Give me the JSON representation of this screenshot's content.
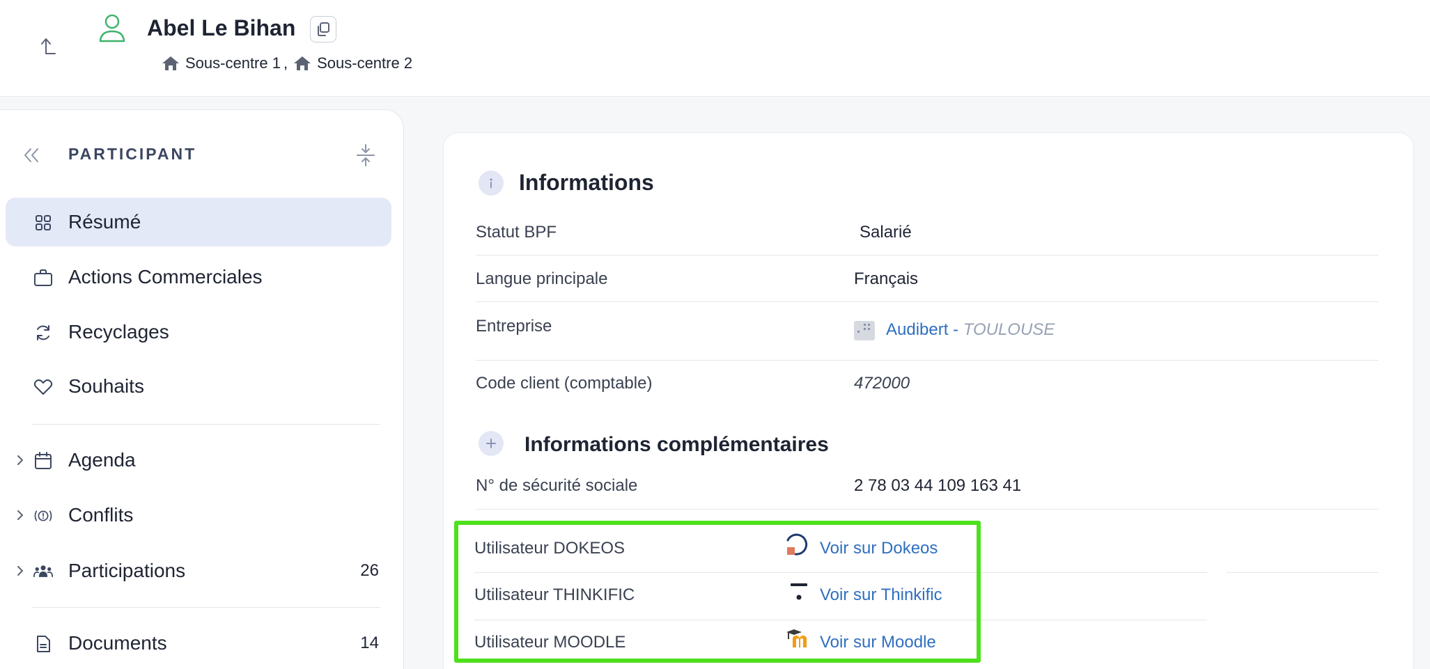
{
  "header": {
    "name": "Abel Le Bihan",
    "centers": [
      "Sous-centre 1",
      "Sous-centre 2"
    ],
    "center_separator": ","
  },
  "sidebar": {
    "title": "PARTICIPANT",
    "items": [
      {
        "label": "Résumé",
        "active": true
      },
      {
        "label": "Actions Commerciales"
      },
      {
        "label": "Recyclages"
      },
      {
        "label": "Souhaits"
      },
      {
        "label": "Agenda"
      },
      {
        "label": "Conflits"
      },
      {
        "label": "Participations",
        "count": "26"
      },
      {
        "label": "Documents",
        "count": "14"
      }
    ]
  },
  "informations": {
    "title": "Informations",
    "rows": [
      {
        "label": "Statut BPF",
        "value": "Salarié"
      },
      {
        "label": "Langue principale",
        "value": "Français"
      },
      {
        "label": "Entreprise",
        "value": "Audibert",
        "separator": " - ",
        "city": "TOULOUSE"
      },
      {
        "label": "Code client (comptable)",
        "value": "472000"
      }
    ]
  },
  "complementaires": {
    "title": "Informations complémentaires",
    "rows": [
      {
        "label": "N° de sécurité sociale",
        "value": "2 78 03 44 109 163 41"
      }
    ]
  },
  "integrations": [
    {
      "label": "Utilisateur DOKEOS",
      "link": "Voir sur Dokeos",
      "icon": "dokeos-icon"
    },
    {
      "label": "Utilisateur THINKIFIC",
      "link": "Voir sur Thinkific",
      "icon": "thinkific-icon"
    },
    {
      "label": "Utilisateur MOODLE",
      "link": "Voir sur Moodle",
      "icon": "moodle-icon"
    }
  ],
  "colors": {
    "accent": "#2f6fc0",
    "active_bg": "#e4e9f8",
    "highlight": "#4ee01c",
    "person_icon": "#3fb36b"
  }
}
